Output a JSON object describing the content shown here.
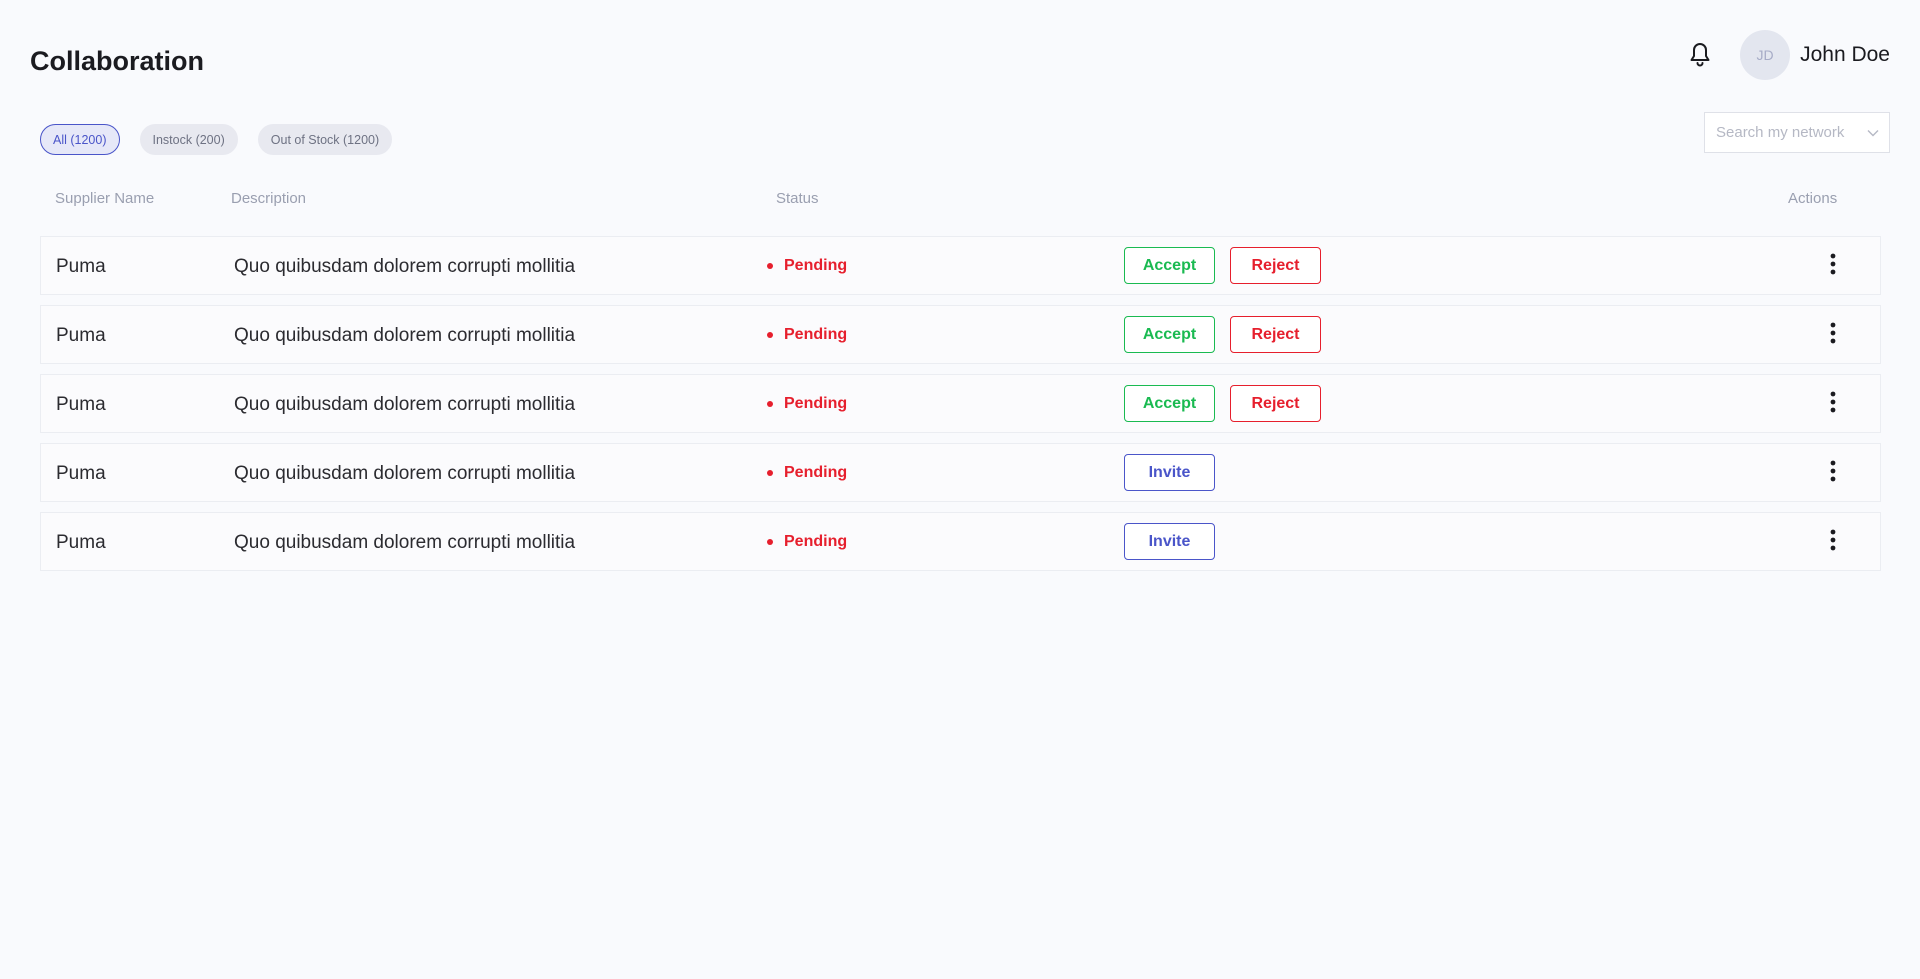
{
  "header": {
    "title": "Collaboration",
    "user": {
      "initials": "JD",
      "name": "John Doe"
    }
  },
  "filters": [
    {
      "label": "All (1200)",
      "active": true
    },
    {
      "label": "Instock (200)",
      "active": false
    },
    {
      "label": "Out of Stock (1200)",
      "active": false
    }
  ],
  "search": {
    "placeholder": "Search my network",
    "value": ""
  },
  "table": {
    "columns": {
      "supplier": "Supplier Name",
      "description": "Description",
      "status": "Status",
      "actions": "Actions"
    },
    "rows": [
      {
        "supplier": "Puma",
        "description": "Quo quibusdam dolorem corrupti mollitia",
        "status": "Pending",
        "accept_label": "Accept",
        "reject_label": "Reject"
      },
      {
        "supplier": "Puma",
        "description": "Quo quibusdam dolorem corrupti mollitia",
        "status": "Pending",
        "accept_label": "Accept",
        "reject_label": "Reject"
      },
      {
        "supplier": "Puma",
        "description": "Quo quibusdam dolorem corrupti mollitia",
        "status": "Pending",
        "accept_label": "Accept",
        "reject_label": "Reject"
      },
      {
        "supplier": "Puma",
        "description": "Quo quibusdam dolorem corrupti mollitia",
        "status": "Pending",
        "invite_label": "Invite"
      },
      {
        "supplier": "Puma",
        "description": "Quo quibusdam dolorem corrupti mollitia",
        "status": "Pending",
        "invite_label": "Invite"
      }
    ]
  },
  "icons": {
    "notifications": "bell-icon",
    "search_dropdown": "chevron-down-icon",
    "row_menu": "more-vertical-icon"
  },
  "colors": {
    "accent": "#4a55c9",
    "pending": "#e61f2d",
    "accept": "#1aba51",
    "reject": "#e61f2d"
  }
}
